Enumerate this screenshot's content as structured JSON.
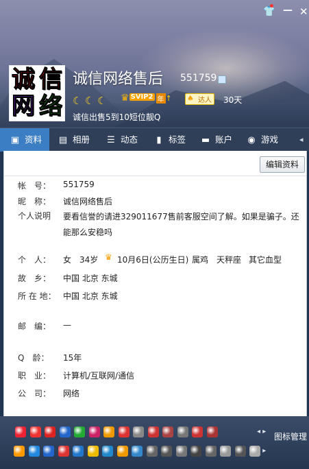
{
  "window": {
    "skin_icon": "tshirt-icon",
    "min_icon": "minimize-icon",
    "close_icon": "close-icon",
    "close_glyph": "✕",
    "min_glyph": "—",
    "skin_glyph": "👕"
  },
  "profile": {
    "avatar_text": [
      "诚",
      "信",
      "网",
      "络"
    ],
    "nickname": "诚信网络售后",
    "qq_number": "551759",
    "level_moons": 3,
    "vip_label": "SVIP2",
    "vip_year": "年",
    "talent_label": "达人",
    "days": "30天",
    "signature": "诚信出售5到10短位靓Q"
  },
  "tabs": [
    {
      "label": "资料",
      "icon": "id-card-icon",
      "glyph": "▣",
      "active": true
    },
    {
      "label": "相册",
      "icon": "photo-album-icon",
      "glyph": "▤",
      "active": false
    },
    {
      "label": "动态",
      "icon": "feed-icon",
      "glyph": "☰",
      "active": false
    },
    {
      "label": "标签",
      "icon": "bookmark-icon",
      "glyph": "▮",
      "active": false
    },
    {
      "label": "账户",
      "icon": "wallet-icon",
      "glyph": "▬",
      "active": false
    },
    {
      "label": "游戏",
      "icon": "game-icon",
      "glyph": "◉",
      "active": false
    }
  ],
  "tabs_more_glyph": "◂",
  "edit_button": "编辑资料",
  "fields": {
    "account": {
      "label": "帐　号：",
      "value": "551759"
    },
    "nickname": {
      "label": "昵　称：",
      "value": "诚信网络售后"
    },
    "intro": {
      "label": "个人说明",
      "value": "要看信誉的请进329011677售前客服空间了解。如果是骗子。还能那么安稳吗"
    },
    "personal": {
      "label": "个　人：",
      "gender": "女",
      "age": "34岁",
      "birthday": "10月6日(公历生日)",
      "zodiac": "属鸡",
      "constellation": "天秤座",
      "blood": "其它血型"
    },
    "hometown": {
      "label": "故　乡：",
      "value": "中国 北京 东城"
    },
    "location": {
      "label": "所 在 地：",
      "value": "中国 北京 东城"
    },
    "postcode": {
      "label": "邮　编：",
      "value": "—"
    },
    "qage": {
      "label": "Q　龄：",
      "value": "15年"
    },
    "job": {
      "label": "职　业：",
      "value": "计算机/互联网/通信"
    },
    "company": {
      "label": "公　司：",
      "value": "网络"
    }
  },
  "tray": {
    "label": "图标管理",
    "more_glyph": "◂ ▸",
    "row1_colors": [
      "#e23",
      "#e33",
      "#d22",
      "#26c",
      "#2a3",
      "#c26",
      "#e90",
      "#d33",
      "#888",
      "#c33",
      "#a44",
      "#777",
      "#c33",
      "#a33"
    ],
    "row2_colors": [
      "#f90",
      "#28d",
      "#26c",
      "#d33",
      "#27c",
      "#eb0",
      "#28c",
      "#e90",
      "#38c",
      "#666",
      "#555",
      "#777",
      "#444",
      "#666",
      "#999",
      "#555",
      "#aaa"
    ]
  }
}
